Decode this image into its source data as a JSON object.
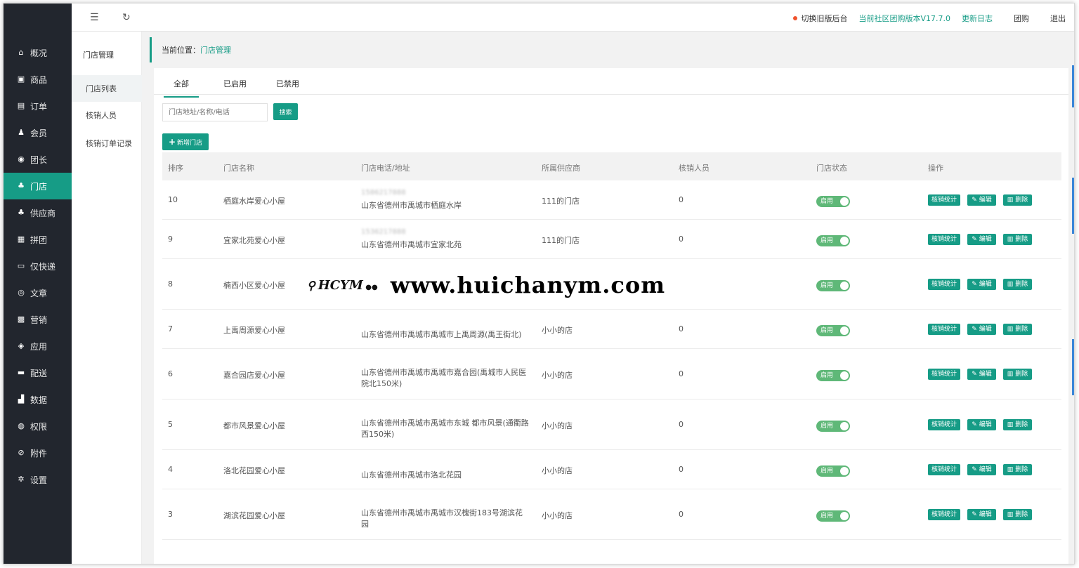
{
  "topbar": {
    "switch_old": "切换旧版后台",
    "version": "当前社区团购版本V17.7.0",
    "changelog": "更新日志",
    "group_buy": "团购",
    "logout": "退出"
  },
  "sidebar": {
    "items": [
      {
        "label": "概况",
        "icon": "home-icon"
      },
      {
        "label": "商品",
        "icon": "goods-icon"
      },
      {
        "label": "订单",
        "icon": "order-icon"
      },
      {
        "label": "会员",
        "icon": "member-icon"
      },
      {
        "label": "团长",
        "icon": "leader-icon"
      },
      {
        "label": "门店",
        "icon": "store-icon"
      },
      {
        "label": "供应商",
        "icon": "supplier-icon"
      },
      {
        "label": "拼团",
        "icon": "pintuan-icon"
      },
      {
        "label": "仅快递",
        "icon": "express-icon"
      },
      {
        "label": "文章",
        "icon": "article-icon"
      },
      {
        "label": "营销",
        "icon": "marketing-icon"
      },
      {
        "label": "应用",
        "icon": "app-icon"
      },
      {
        "label": "配送",
        "icon": "delivery-icon"
      },
      {
        "label": "数据",
        "icon": "data-icon"
      },
      {
        "label": "权限",
        "icon": "permission-icon"
      },
      {
        "label": "附件",
        "icon": "attachment-icon"
      },
      {
        "label": "设置",
        "icon": "settings-icon"
      }
    ]
  },
  "subnav": {
    "title": "门店管理",
    "items": [
      "门店列表",
      "核销人员",
      "核销订单记录"
    ]
  },
  "breadcrumb": {
    "prefix": "当前位置：",
    "current": "门店管理"
  },
  "tabs": [
    "全部",
    "已启用",
    "已禁用"
  ],
  "search": {
    "placeholder": "门店地址/名称/电话",
    "button": "搜索"
  },
  "add_button": "新增门店",
  "table": {
    "headers": [
      "排序",
      "门店名称",
      "门店电话/地址",
      "所属供应商",
      "核销人员",
      "门店状态",
      "操作"
    ],
    "status_label": "启用",
    "ops": [
      "核销统计",
      "编辑",
      "删除"
    ],
    "rows": [
      {
        "sort": "10",
        "name": "栖庭水岸爱心小屋",
        "phone": "1586217888",
        "addr": "山东省德州市禹城市栖庭水岸",
        "supplier": "111的门店",
        "staff": "0"
      },
      {
        "sort": "9",
        "name": "宜家北苑爱心小屋",
        "phone": "1536217888",
        "addr": "山东省德州市禹城市宜家北苑",
        "supplier": "111的门店",
        "staff": "0"
      },
      {
        "sort": "8",
        "name": "楠西小区爱心小屋",
        "phone": "",
        "addr": "",
        "supplier": "",
        "staff": ""
      },
      {
        "sort": "7",
        "name": "上禹周源爱心小屋",
        "phone": "",
        "addr": "山东省德州市禹城市禹城市上禹周源(禹王街北)",
        "supplier": "小小的店",
        "staff": "0"
      },
      {
        "sort": "6",
        "name": "嘉合园店爱心小屋",
        "phone": "",
        "addr": "山东省德州市禹城市禹城市嘉合园(禹城市人民医院北150米)",
        "supplier": "小小的店",
        "staff": "0"
      },
      {
        "sort": "5",
        "name": "都市风景爱心小屋",
        "phone": "",
        "addr": "山东省德州市禹城市禹城市东城 都市风景(通衢路西150米)",
        "supplier": "小小的店",
        "staff": "0"
      },
      {
        "sort": "4",
        "name": "洛北花园爱心小屋",
        "phone": "",
        "addr": "山东省德州市禹城市洛北花园",
        "supplier": "小小的店",
        "staff": "0"
      },
      {
        "sort": "3",
        "name": "湖滨花园爱心小屋",
        "phone": "",
        "addr": "山东省德州市禹城市禹城市汉槐街183号湖滨花园",
        "supplier": "小小的店",
        "staff": "0"
      }
    ]
  },
  "watermark": {
    "logo": "HCYM",
    "url": "www.huichanym.com"
  },
  "colors": {
    "accent": "#169c86",
    "sidebar_bg": "#22262e",
    "switch_on": "#5fb878",
    "alert_dot": "#f0522c"
  }
}
